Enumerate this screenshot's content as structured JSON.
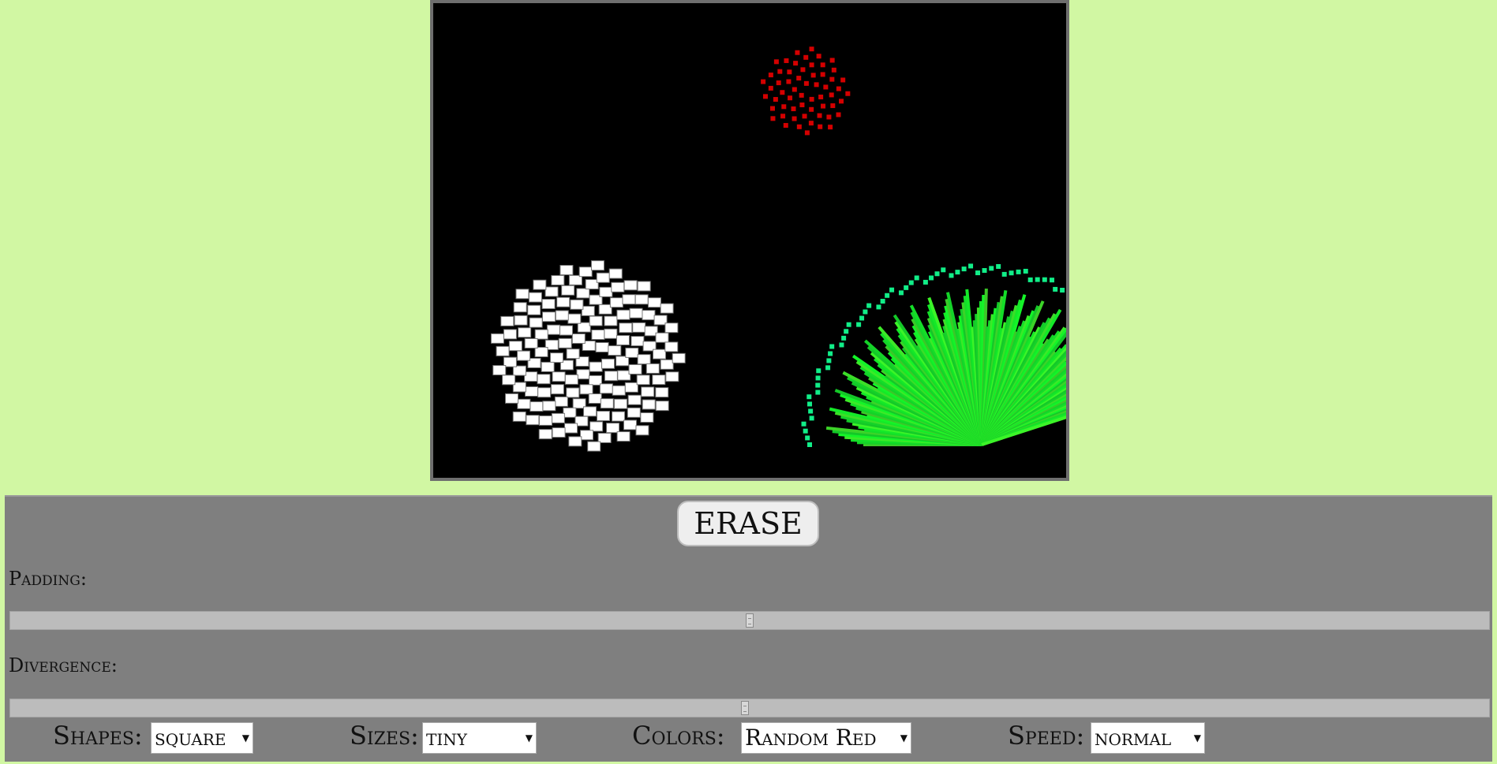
{
  "controls": {
    "erase_label": "ERASE",
    "padding_label": "Padding:",
    "divergence_label": "Divergence:",
    "padding_value": 0.5,
    "divergence_value": 0.497,
    "shapes_label": "Shapes:",
    "shapes_value": "square",
    "sizes_label": "Sizes:",
    "sizes_value": "tiny",
    "colors_label": "Colors:",
    "colors_value": "Random Red",
    "speed_label": "Speed:",
    "speed_value": "normal"
  },
  "colors": {
    "page_background": "#d1f7a3",
    "panel_background": "#7f7f7f",
    "canvas_background": "#000000",
    "red_cluster": "#d40000",
    "green_burst": "#22ff22",
    "teal_dots": "#11ee88",
    "white_cluster": "#ffffff"
  },
  "icons": {
    "dropdown_caret": "caret-down-icon"
  }
}
